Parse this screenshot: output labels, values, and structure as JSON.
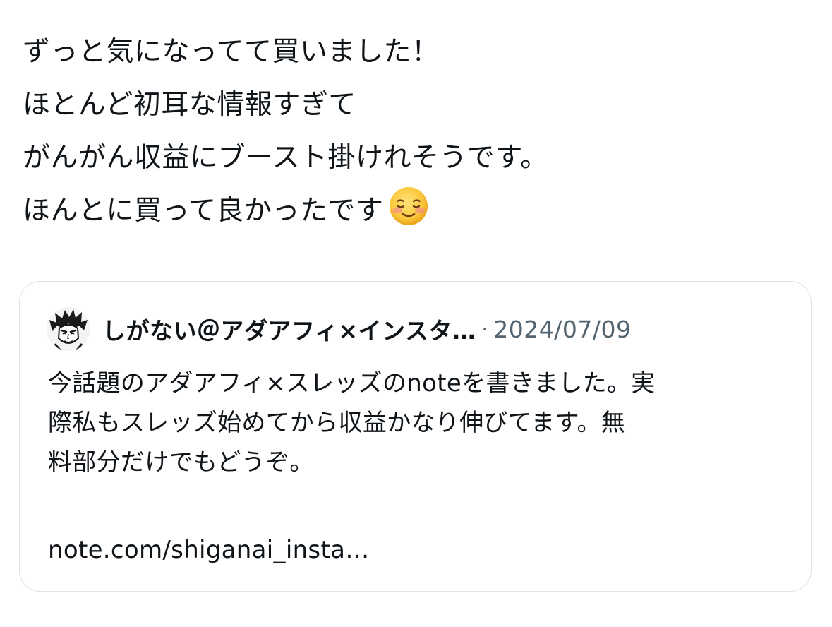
{
  "post": {
    "lines": [
      "ずっと気になってて買いました！",
      "ほとんど初耳な情報すぎて",
      "がんがん収益にブースト掛けれそうです。",
      "ほんとに買って良かったです"
    ],
    "emoji": "smiling-face-icon"
  },
  "quote": {
    "author": {
      "name": "しがない＠アダアフィ×インスタ…",
      "avatar_icon": "avatar-illustration"
    },
    "separator": "·",
    "date": "2024/07/09",
    "body_lines": [
      "今話題のアダアフィ×スレッズのnoteを書きました。実",
      "際私もスレッズ始めてから収益かなり伸びてます。無",
      "料部分だけでもどうぞ。"
    ],
    "link": "note.com/shiganai_insta…"
  },
  "colors": {
    "text": "#0f1419",
    "secondary_text": "#536471",
    "card_border": "#dfe3e6",
    "background": "#ffffff"
  }
}
